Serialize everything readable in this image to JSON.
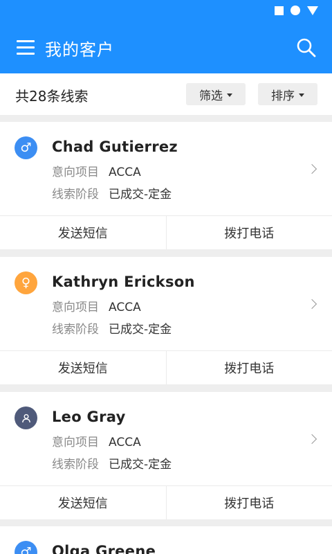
{
  "header": {
    "title": "我的客户"
  },
  "filterbar": {
    "count_label": "共28条线索",
    "filter_label": "筛选",
    "sort_label": "排序"
  },
  "labels": {
    "project": "意向项目",
    "stage": "线索阶段",
    "sms": "发送短信",
    "call": "拨打电话"
  },
  "customers": [
    {
      "name": "Chad Gutierrez",
      "gender": "male",
      "project": "ACCA",
      "stage": "已成交-定金"
    },
    {
      "name": "Kathryn Erickson",
      "gender": "female",
      "project": "ACCA",
      "stage": "已成交-定金"
    },
    {
      "name": "Leo Gray",
      "gender": "unknown",
      "project": "ACCA",
      "stage": "已成交-定金"
    },
    {
      "name": "Olga Greene",
      "gender": "male",
      "project": "",
      "stage": ""
    }
  ],
  "colors": {
    "primary": "#1e90ff",
    "male": "#3c8ef3",
    "female": "#ffa53d",
    "unknown": "#4f5a7a"
  }
}
